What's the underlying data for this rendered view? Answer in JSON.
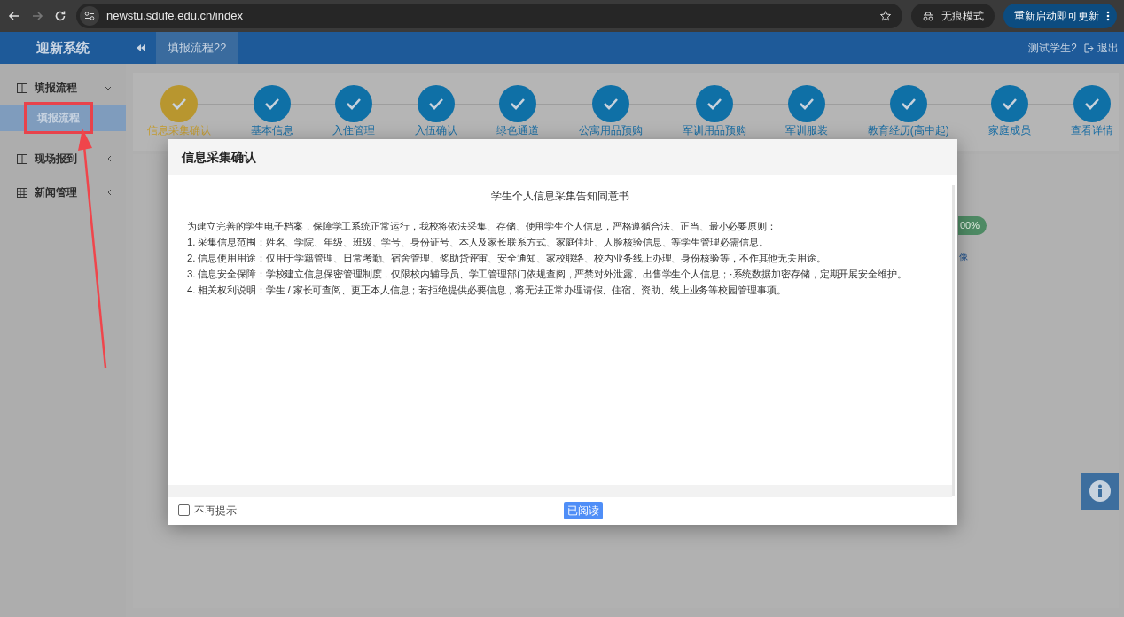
{
  "browser": {
    "url": "newstu.sdufe.edu.cn/index",
    "incognito_label": "无痕模式",
    "update_button": "重新启动即可更新"
  },
  "app": {
    "title": "迎新系统",
    "tab": "填报流程22",
    "user": "测试学生2",
    "logout": "退出"
  },
  "sidebar": {
    "items": [
      {
        "label": "填报流程",
        "expanded": true,
        "kind": "panel",
        "children": [
          {
            "label": "填报流程",
            "selected": true
          }
        ]
      },
      {
        "label": "现场报到",
        "expanded": false,
        "kind": "panel"
      },
      {
        "label": "新闻管理",
        "expanded": false,
        "kind": "grid"
      }
    ]
  },
  "steps": [
    {
      "label": "信息采集确认",
      "current": true
    },
    {
      "label": "基本信息",
      "current": false
    },
    {
      "label": "入住管理",
      "current": false
    },
    {
      "label": "入伍确认",
      "current": false
    },
    {
      "label": "绿色通道",
      "current": false
    },
    {
      "label": "公寓用品预购",
      "current": false
    },
    {
      "label": "军训用品预购",
      "current": false
    },
    {
      "label": "军训服装",
      "current": false
    },
    {
      "label": "教育经历(高中起)",
      "current": false
    },
    {
      "label": "家庭成员",
      "current": false
    },
    {
      "label": "查看详情",
      "current": false
    }
  ],
  "behind": {
    "badge": "00%",
    "link": "像"
  },
  "dialog": {
    "title": "信息采集确认",
    "heading": "学生个人信息采集告知同意书",
    "paragraphs": [
      "为建立完善的学生电子档案，保障学工系统正常运行，我校将依法采集、存储、使用学生个人信息，严格遵循合法、正当、最小必要原则：",
      "1. 采集信息范围：姓名、学院、年级、班级、学号、身份证号、本人及家长联系方式、家庭住址、人脸核验信息、等学生管理必需信息。",
      "2. 信息使用用途：仅用于学籍管理、日常考勤、宿舍管理、奖助贷评审、安全通知、家校联络、校内业务线上办理、身份核验等，不作其他无关用途。",
      "3. 信息安全保障：学校建立信息保密管理制度，仅限校内辅导员、学工管理部门依规查阅，严禁对外泄露、出售学生个人信息；·系统数据加密存储，定期开展安全维护。",
      "4. 相关权利说明：学生 / 家长可查阅、更正本人信息；若拒绝提供必要信息，将无法正常办理请假、住宿、资助、线上业务等校园管理事项。"
    ],
    "dont_show": {
      "label": "不再提示",
      "checked": false
    },
    "confirm_button": "已阅读"
  }
}
